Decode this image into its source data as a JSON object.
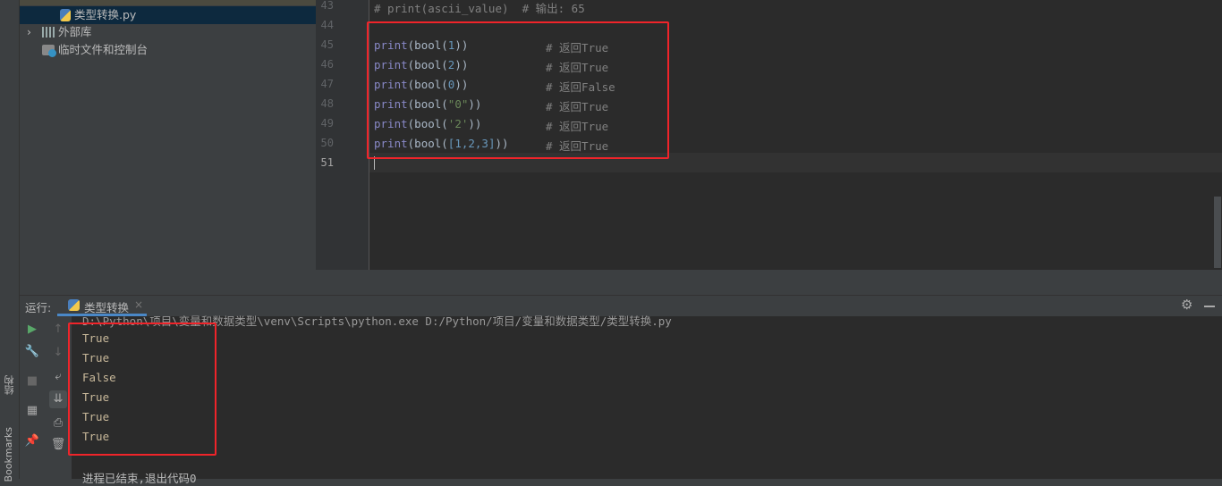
{
  "project": {
    "items": [
      {
        "label": "类型转换.py",
        "icon": "python-file-icon"
      },
      {
        "label": "外部库",
        "icon": "library-icon"
      },
      {
        "label": "临时文件和控制台",
        "icon": "scratch-icon"
      }
    ]
  },
  "side_tabs": {
    "structure": "结构",
    "bookmarks": "Bookmarks"
  },
  "editor": {
    "lines": [
      {
        "n": "43",
        "code": "# print(ascii_value)  # 输出: 65"
      },
      {
        "n": "44",
        "code": ""
      },
      {
        "n": "45",
        "fn": "print",
        "arg": "1",
        "cm": "# 返回True"
      },
      {
        "n": "46",
        "fn": "print",
        "arg": "2",
        "cm": "# 返回True"
      },
      {
        "n": "47",
        "fn": "print",
        "arg": "0",
        "cm": "# 返回False"
      },
      {
        "n": "48",
        "fn": "print",
        "arg": "\"0\"",
        "cm": "# 返回True"
      },
      {
        "n": "49",
        "fn": "print",
        "arg": "'2'",
        "cm": "# 返回True"
      },
      {
        "n": "50",
        "fn": "print",
        "arg": "[1,2,3]",
        "cm": "# 返回True"
      },
      {
        "n": "51",
        "code": ""
      }
    ]
  },
  "run": {
    "label": "运行:",
    "tab": "类型转换",
    "command": "D:\\Python\\项目\\变量和数据类型\\venv\\Scripts\\python.exe D:/Python/项目/变量和数据类型/类型转换.py",
    "output": [
      "True",
      "True",
      "False",
      "True",
      "True",
      "True"
    ],
    "exit": "进程已结束,退出代码0"
  }
}
